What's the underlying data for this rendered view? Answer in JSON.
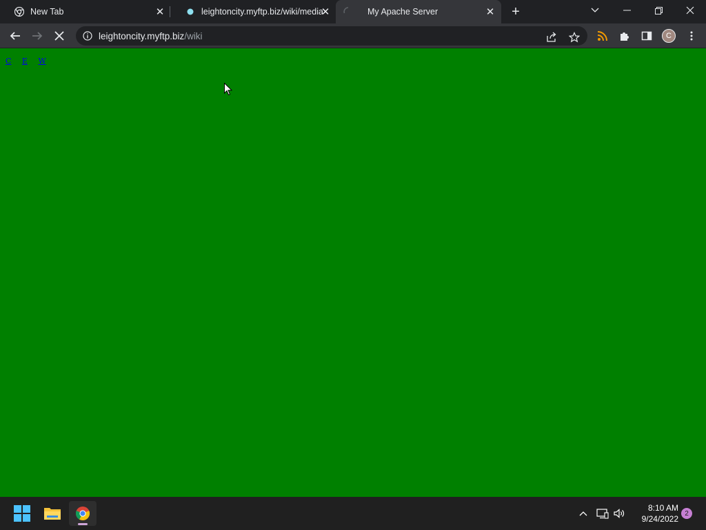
{
  "browser": {
    "tabs": [
      {
        "label": "New Tab",
        "icon": "chrome-icon"
      },
      {
        "label": "leightoncity.myftp.biz/wiki/media",
        "icon": "site-favicon"
      },
      {
        "label": "My Apache Server",
        "icon": "loading-spinner-icon"
      }
    ],
    "new_tab_label": "+",
    "address": {
      "host": "leightoncity.myftp.biz",
      "path": "/wiki"
    },
    "profile_initial": "C"
  },
  "page": {
    "links": [
      "C",
      "E",
      "W"
    ],
    "background": "#008000"
  },
  "taskbar": {
    "time": "8:10 AM",
    "date": "9/24/2022",
    "notification_count": "2"
  }
}
